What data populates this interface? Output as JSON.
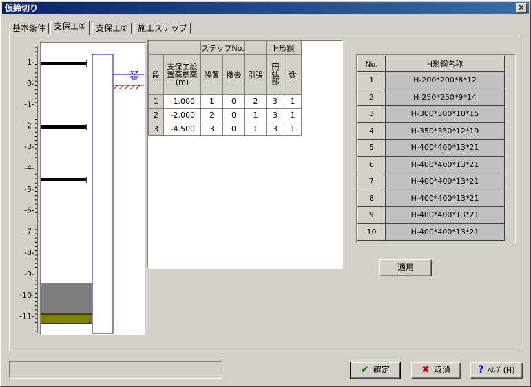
{
  "window": {
    "title": "仮締切り",
    "close_glyph": "✕"
  },
  "tabs": [
    "基本条件",
    "支保工①",
    "支保工②",
    "施工ステップ"
  ],
  "diagram": {
    "y_ticks": [
      "1-",
      "0-",
      "-1-",
      "-2-",
      "-3-",
      "-4-",
      "-5-",
      "-6-",
      "-7-",
      "-8-",
      "-9-",
      "-10-",
      "-11-"
    ],
    "water_icon": "water-level-icon",
    "ground_icon": "ground-hatch-icon",
    "colors": {
      "soil_gray": "#7f7f7f",
      "soil_olive": "#7f7f00",
      "wall": "#0000c0",
      "strut": "#000000"
    }
  },
  "grid": {
    "group_headers": {
      "step_no": "ステップNo.",
      "h_steel": "H形鋼"
    },
    "columns": {
      "stage": "段",
      "elevation": "支保工設置高標高(m)",
      "install": "設置",
      "removal": "撤去",
      "tension": "引張",
      "arc": "円弧部",
      "count": "数"
    },
    "rows": [
      {
        "stage": "1",
        "elevation": "1.000",
        "install": "1",
        "removal": "0",
        "tension": "2",
        "arc": "3",
        "count": "1"
      },
      {
        "stage": "2",
        "elevation": "-2.000",
        "install": "2",
        "removal": "0",
        "tension": "1",
        "arc": "3",
        "count": "1"
      },
      {
        "stage": "3",
        "elevation": "-4.500",
        "install": "3",
        "removal": "0",
        "tension": "1",
        "arc": "3",
        "count": "1"
      }
    ]
  },
  "hsteel": {
    "headers": {
      "no": "No.",
      "name": "H形鋼名称"
    },
    "rows": [
      {
        "no": "1",
        "name": "H-200*200*8*12"
      },
      {
        "no": "2",
        "name": "H-250*250*9*14"
      },
      {
        "no": "3",
        "name": "H-300*300*10*15"
      },
      {
        "no": "4",
        "name": "H-350*350*12*19"
      },
      {
        "no": "5",
        "name": "H-400*400*13*21"
      },
      {
        "no": "6",
        "name": "H-400*400*13*21"
      },
      {
        "no": "7",
        "name": "H-400*400*13*21"
      },
      {
        "no": "8",
        "name": "H-400*400*13*21"
      },
      {
        "no": "9",
        "name": "H-400*400*13*21"
      },
      {
        "no": "10",
        "name": "H-400*400*13*21"
      }
    ]
  },
  "buttons": {
    "apply": "適用",
    "ok": "確定",
    "cancel": "取消",
    "help": "ﾍﾙﾌﾟ(H)"
  },
  "icons": {
    "ok": "checkmark-icon",
    "cancel": "cross-icon",
    "help": "question-icon"
  },
  "status_text": ""
}
